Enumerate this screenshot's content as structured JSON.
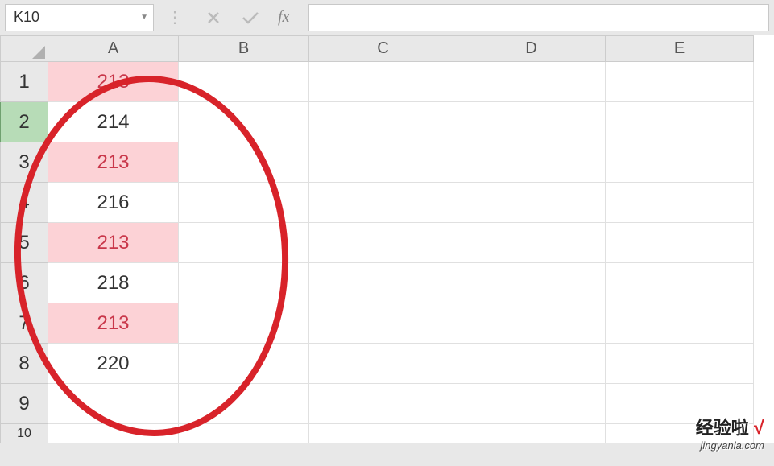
{
  "formula_bar": {
    "cell_ref": "K10",
    "fx_label": "fx",
    "formula_value": ""
  },
  "columns": [
    "A",
    "B",
    "C",
    "D",
    "E"
  ],
  "rows": [
    {
      "num": "1",
      "A": "213",
      "hl": true
    },
    {
      "num": "2",
      "A": "214",
      "hl": false,
      "active_head": true
    },
    {
      "num": "3",
      "A": "213",
      "hl": true
    },
    {
      "num": "4",
      "A": "216",
      "hl": false
    },
    {
      "num": "5",
      "A": "213",
      "hl": true
    },
    {
      "num": "6",
      "A": "218",
      "hl": false
    },
    {
      "num": "7",
      "A": "213",
      "hl": true
    },
    {
      "num": "8",
      "A": "220",
      "hl": false
    },
    {
      "num": "9",
      "A": "",
      "hl": false
    }
  ],
  "partial_row": "10",
  "watermark": {
    "title": "经验啦",
    "check": "√",
    "url": "jingyanla.com"
  }
}
